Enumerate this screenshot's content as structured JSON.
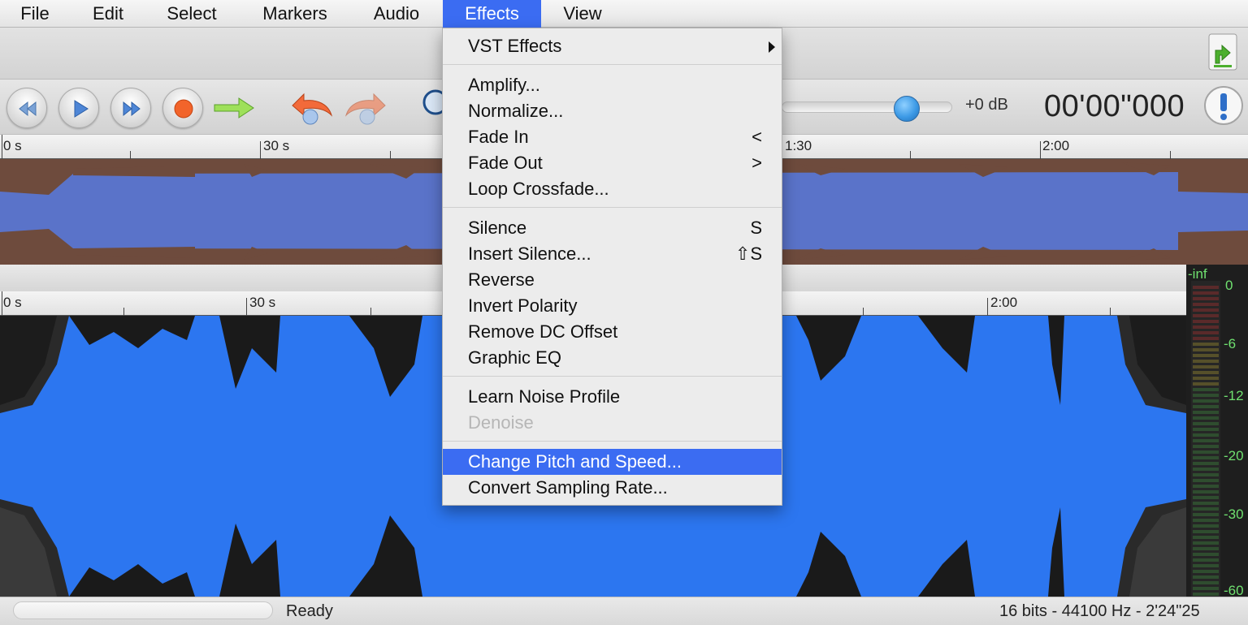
{
  "menubar": {
    "items": [
      "File",
      "Edit",
      "Select",
      "Markers",
      "Audio",
      "Effects",
      "View"
    ],
    "active": "Effects"
  },
  "transport": {
    "volume_label": "+0 dB",
    "time": "00'00\"000"
  },
  "rulers": {
    "overview_labels": [
      "0 s",
      "30 s",
      "1:30",
      "2:00"
    ],
    "main_labels": [
      "0 s",
      "30 s",
      "2:00"
    ]
  },
  "meter": {
    "labels": [
      "-inf",
      "0",
      "-6",
      "-12",
      "-20",
      "-30",
      "-60"
    ]
  },
  "effects_menu": {
    "vst": "VST Effects",
    "amplify": "Amplify...",
    "normalize": "Normalize...",
    "fade_in": "Fade In",
    "fade_in_shortcut": "<",
    "fade_out": "Fade Out",
    "fade_out_shortcut": ">",
    "loop_crossfade": "Loop Crossfade...",
    "silence": "Silence",
    "silence_shortcut": "S",
    "insert_silence": "Insert Silence...",
    "insert_silence_shortcut": "⇧S",
    "reverse": "Reverse",
    "invert_polarity": "Invert Polarity",
    "remove_dc": "Remove DC Offset",
    "graphic_eq": "Graphic EQ",
    "learn_noise": "Learn Noise Profile",
    "denoise": "Denoise",
    "change_pitch": "Change Pitch and Speed...",
    "convert_rate": "Convert Sampling Rate..."
  },
  "status": {
    "text": "Ready",
    "format": "16 bits - 44100 Hz - 2'24\"25"
  },
  "colors": {
    "menu_highlight": "#3b6cf2",
    "waveform_main": "#2c76f0",
    "waveform_overview": "#5a73c9",
    "meter_green": "#6fe06f"
  }
}
